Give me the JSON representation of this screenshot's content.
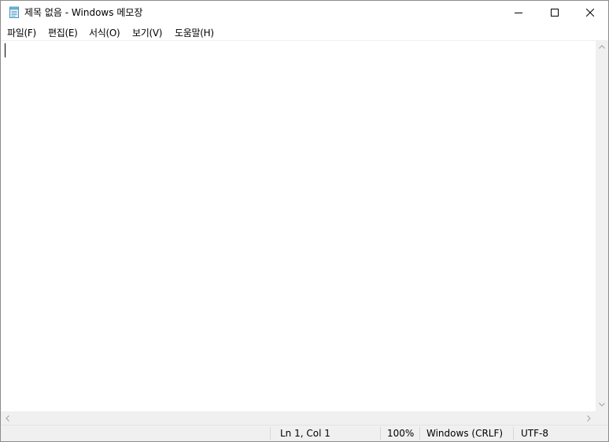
{
  "window": {
    "title": "제목 없음 - Windows 메모장"
  },
  "icons": {
    "app": "notepad-icon",
    "minimize": "minimize-icon",
    "maximize": "maximize-icon",
    "close": "close-icon"
  },
  "menu": {
    "items": [
      {
        "label": "파일(F)"
      },
      {
        "label": "편집(E)"
      },
      {
        "label": "서식(O)"
      },
      {
        "label": "보기(V)"
      },
      {
        "label": "도움말(H)"
      }
    ]
  },
  "editor": {
    "content": ""
  },
  "status": {
    "position": "Ln 1, Col 1",
    "zoom": "100%",
    "line_ending": "Windows (CRLF)",
    "encoding": "UTF-8"
  },
  "colors": {
    "chrome": "#f0f0f0",
    "background": "#ffffff"
  }
}
